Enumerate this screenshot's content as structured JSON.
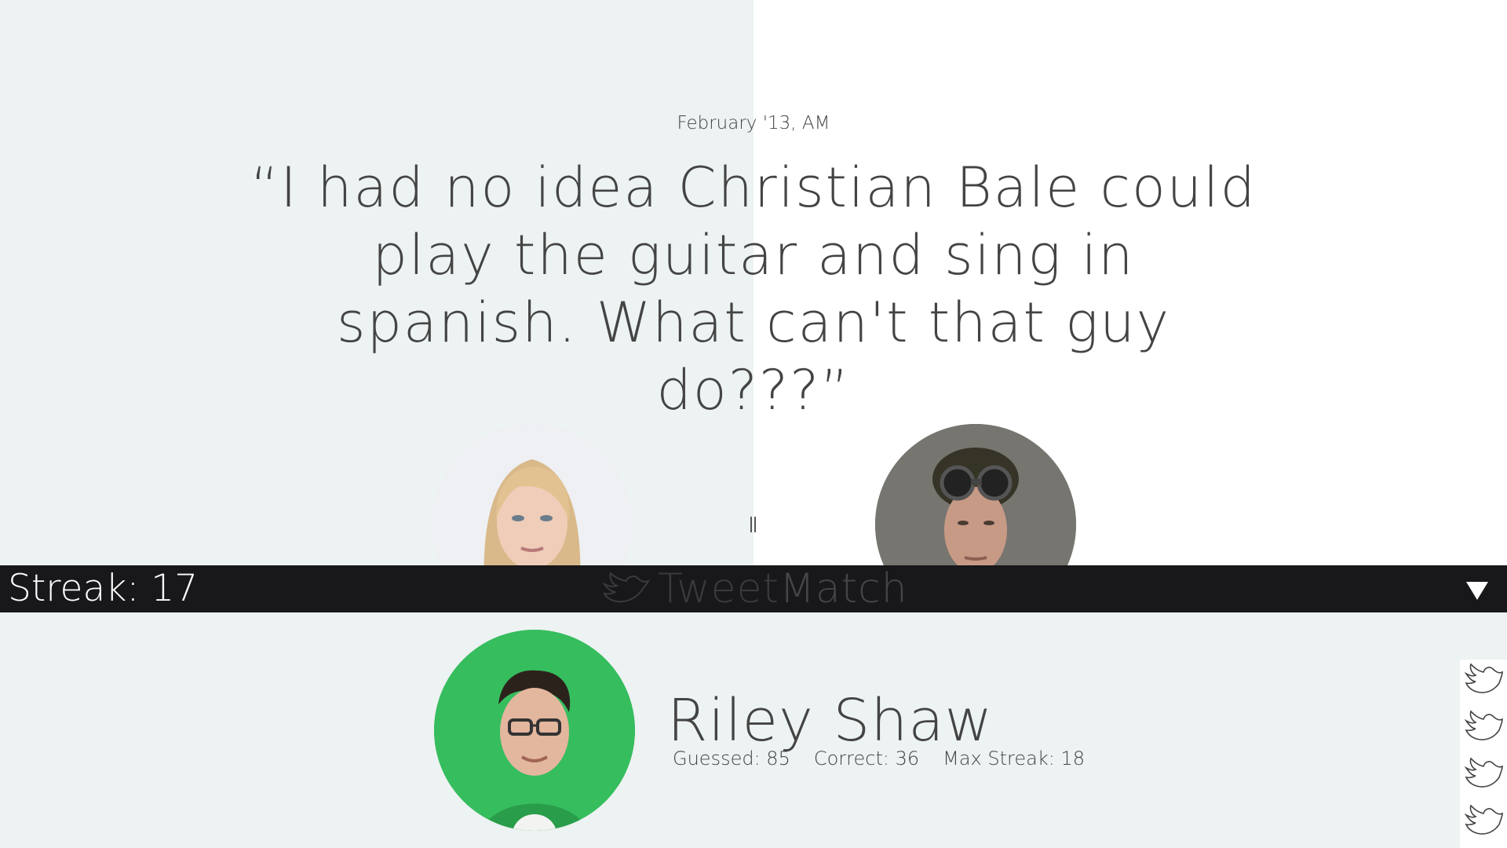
{
  "tweet": {
    "date": "February '13, AM",
    "text": "“I had no idea Christian Bale could play the guitar and sing in spanish. What can't that guy do???”"
  },
  "choices": [
    {
      "name": "choice-left-avatar",
      "description": "blonde woman portrait"
    },
    {
      "name": "choice-right-avatar",
      "description": "man with goggles portrait"
    }
  ],
  "bar": {
    "streak_label": "Streak: 17",
    "logo_light": "Tweet",
    "logo_strong": "Match",
    "toggle_icon": "triangle-down-icon"
  },
  "user": {
    "name": "Riley Shaw",
    "guessed": "Guessed: 85",
    "correct": "Correct: 36",
    "max_streak": "Max Streak: 18"
  },
  "colors": {
    "left_panel": "#edf2f2",
    "right_panel": "#ffffff",
    "bar": "#18171a",
    "text": "#444444",
    "user_bg": "#2fb758"
  }
}
